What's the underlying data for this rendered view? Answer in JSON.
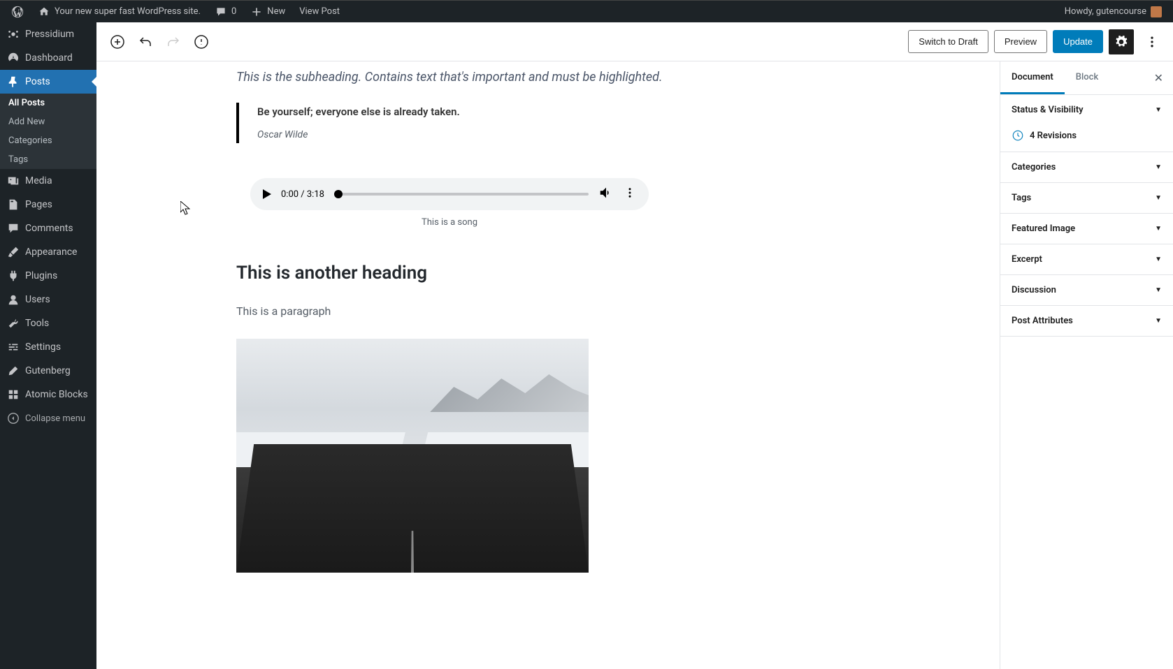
{
  "adminBar": {
    "siteTitle": "Your new super fast WordPress site.",
    "commentCount": "0",
    "newLabel": "New",
    "viewPostLabel": "View Post",
    "howdy": "Howdy, gutencourse"
  },
  "sidebar": {
    "items": [
      {
        "label": "Pressidium",
        "icon": "pressidium"
      },
      {
        "label": "Dashboard",
        "icon": "dashboard"
      },
      {
        "label": "Posts",
        "icon": "pin",
        "current": true
      },
      {
        "label": "Media",
        "icon": "media"
      },
      {
        "label": "Pages",
        "icon": "pages"
      },
      {
        "label": "Comments",
        "icon": "comments"
      },
      {
        "label": "Appearance",
        "icon": "brush"
      },
      {
        "label": "Plugins",
        "icon": "plug"
      },
      {
        "label": "Users",
        "icon": "user"
      },
      {
        "label": "Tools",
        "icon": "wrench"
      },
      {
        "label": "Settings",
        "icon": "sliders"
      },
      {
        "label": "Gutenberg",
        "icon": "pencil"
      },
      {
        "label": "Atomic Blocks",
        "icon": "atomic"
      }
    ],
    "submenu": [
      {
        "label": "All Posts",
        "current": true
      },
      {
        "label": "Add New"
      },
      {
        "label": "Categories"
      },
      {
        "label": "Tags"
      }
    ],
    "collapse": "Collapse menu"
  },
  "editorHeader": {
    "buttons": {
      "switchToDraft": "Switch to Draft",
      "preview": "Preview",
      "update": "Update"
    }
  },
  "content": {
    "subheading": "This is the subheading. Contains text that's important and must be highlighted.",
    "quote": {
      "text": "Be yourself; everyone else is already taken.",
      "cite": "Oscar Wilde"
    },
    "audio": {
      "time": "0:00 / 3:18",
      "caption": "This is a song"
    },
    "heading2": "This is another heading",
    "paragraph": "This is a paragraph"
  },
  "settingsPanel": {
    "tabs": {
      "document": "Document",
      "block": "Block"
    },
    "sections": {
      "statusVisibility": "Status & Visibility",
      "revisions": "4 Revisions",
      "categories": "Categories",
      "tags": "Tags",
      "featuredImage": "Featured Image",
      "excerpt": "Excerpt",
      "discussion": "Discussion",
      "postAttributes": "Post Attributes"
    }
  }
}
